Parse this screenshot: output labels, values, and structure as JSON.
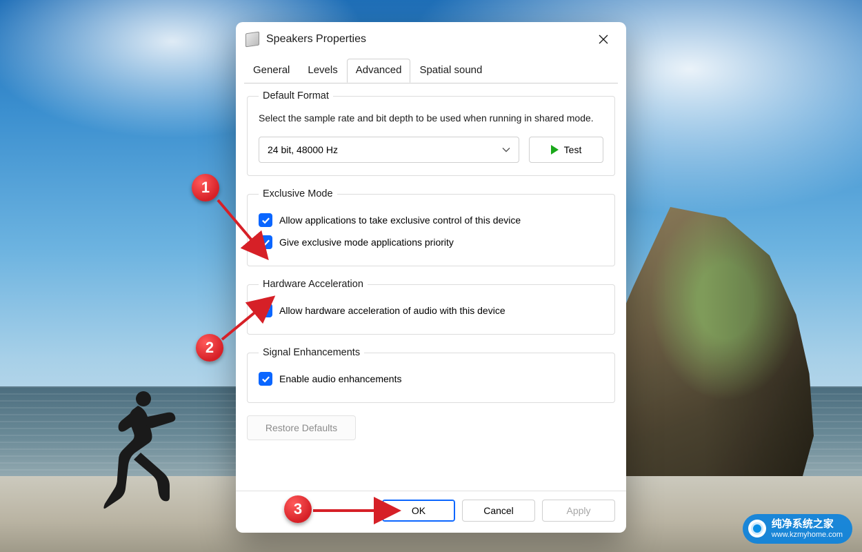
{
  "window": {
    "title": "Speakers Properties"
  },
  "tabs": {
    "general": "General",
    "levels": "Levels",
    "advanced": "Advanced",
    "spatial": "Spatial sound",
    "active": "advanced"
  },
  "defaultFormat": {
    "legend": "Default Format",
    "description": "Select the sample rate and bit depth to be used when running in shared mode.",
    "selected": "24 bit, 48000 Hz",
    "testLabel": "Test"
  },
  "exclusiveMode": {
    "legend": "Exclusive Mode",
    "allowExclusive": "Allow applications to take exclusive control of this device",
    "givePriority": "Give exclusive mode applications priority"
  },
  "hardwareAccel": {
    "legend": "Hardware Acceleration",
    "allow": "Allow hardware acceleration of audio with this device"
  },
  "signalEnh": {
    "legend": "Signal Enhancements",
    "enable": "Enable audio enhancements"
  },
  "buttons": {
    "restoreDefaults": "Restore Defaults",
    "ok": "OK",
    "cancel": "Cancel",
    "apply": "Apply"
  },
  "callouts": {
    "one": "1",
    "two": "2",
    "three": "3"
  },
  "watermark": {
    "title": "纯净系统之家",
    "url": "www.kzmyhome.com"
  }
}
